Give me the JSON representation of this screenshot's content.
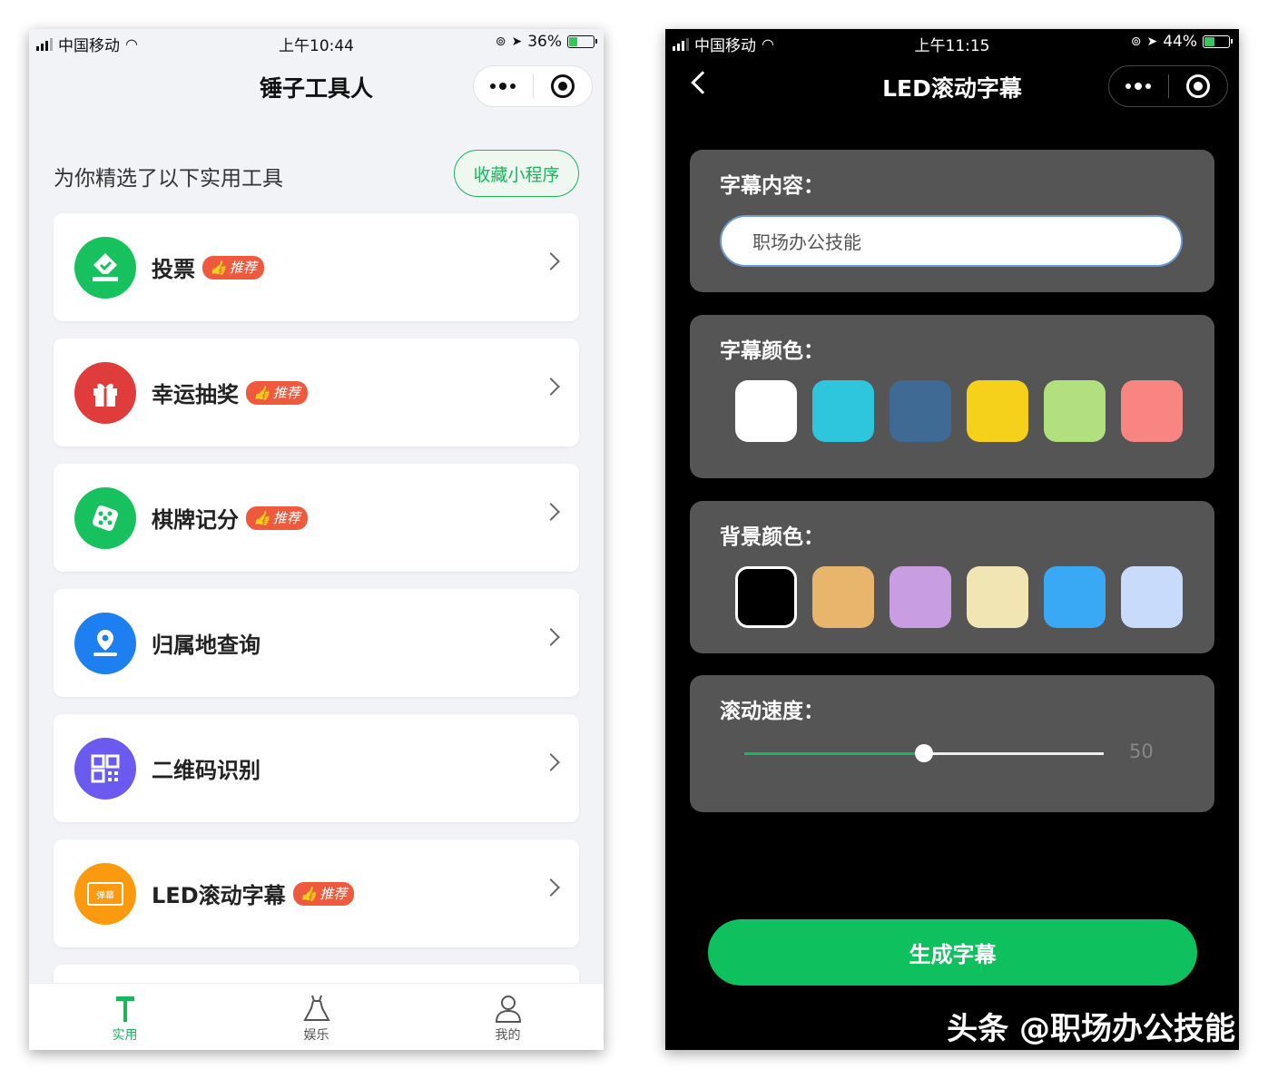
{
  "left_screen": {
    "status": {
      "carrier": "中国移动",
      "time": "上午10:44",
      "battery": "36%",
      "battery_level": 0.36
    },
    "title": "锤子工具人",
    "section_heading": "为你精选了以下实用工具",
    "favorite_button": "收藏小程序",
    "tools": [
      {
        "label": "投票",
        "badge": "推荐",
        "icon": "vote-icon",
        "color": "#17c15e"
      },
      {
        "label": "幸运抽奖",
        "badge": "推荐",
        "icon": "gift-icon",
        "color": "#e03c3c"
      },
      {
        "label": "棋牌记分",
        "badge": "推荐",
        "icon": "dice-icon",
        "color": "#17c15e"
      },
      {
        "label": "归属地查询",
        "badge": "",
        "icon": "location-icon",
        "color": "#1e7ff0"
      },
      {
        "label": "二维码识别",
        "badge": "",
        "icon": "qrcode-icon",
        "color": "#6a5af0"
      },
      {
        "label": "LED滚动字幕",
        "badge": "推荐",
        "icon": "danmu-icon",
        "color": "#fb9a0e"
      }
    ],
    "danmu_icon_text": "弹幕",
    "tabs": [
      {
        "label": "实用",
        "icon": "hammer-icon",
        "active": true
      },
      {
        "label": "娱乐",
        "icon": "dress-icon",
        "active": false
      },
      {
        "label": "我的",
        "icon": "person-icon",
        "active": false
      }
    ],
    "accent_color": "#19b65b"
  },
  "right_screen": {
    "status": {
      "carrier": "中国移动",
      "time": "上午11:15",
      "battery": "44%",
      "battery_level": 0.44
    },
    "title": "LED滚动字幕",
    "content_label": "字幕内容：",
    "content_value": "职场办公技能",
    "text_color_label": "字幕颜色：",
    "text_colors": [
      "#ffffff",
      "#2ec6dc",
      "#3e6a93",
      "#f5d11c",
      "#b3e07f",
      "#f98583"
    ],
    "bg_color_label": "背景颜色：",
    "bg_colors": [
      "#000000",
      "#e8b56c",
      "#c89de2",
      "#f1e6b3",
      "#3aa9f5",
      "#c9dbfb"
    ],
    "bg_selected_index": 0,
    "speed_label": "滚动速度：",
    "speed_value": "50",
    "speed_fraction": 0.5,
    "generate_button": "生成字幕",
    "watermark": "头条 @职场办公技能"
  }
}
